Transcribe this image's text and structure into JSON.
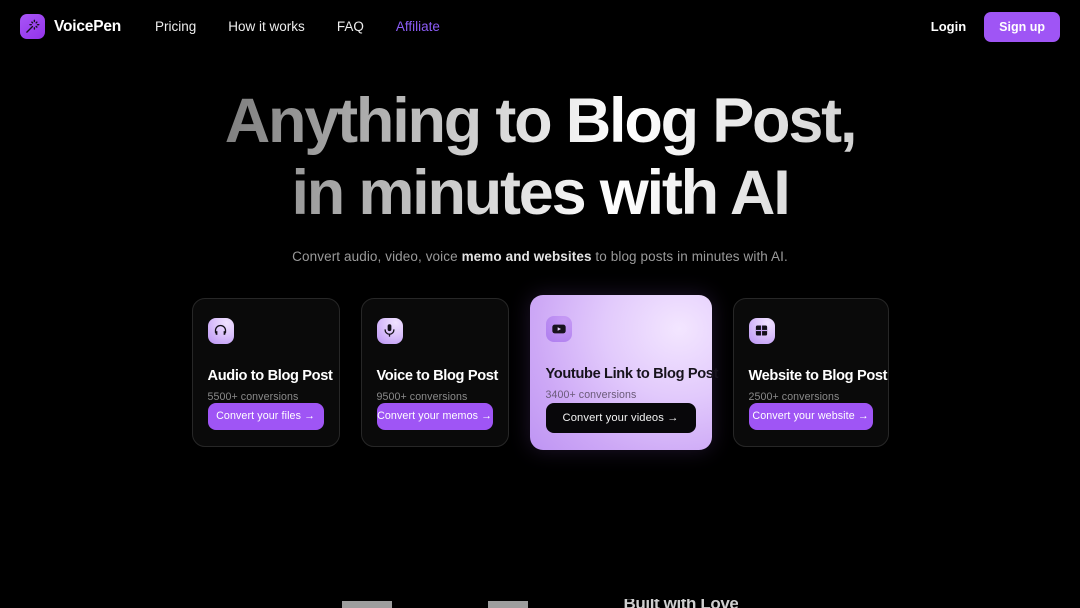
{
  "brand": {
    "name": "VoicePen",
    "logo_icon": "magic-wand-icon",
    "logo_color": "#a855f7"
  },
  "nav": {
    "links": [
      {
        "label": "Pricing",
        "accent": false
      },
      {
        "label": "How it works",
        "accent": false
      },
      {
        "label": "FAQ",
        "accent": false
      },
      {
        "label": "Affiliate",
        "accent": true,
        "color": "#8b5cf6"
      }
    ],
    "login_label": "Login",
    "signup_label": "Sign up",
    "signup_color": "#9f55f5"
  },
  "hero": {
    "headline_line1": "Anything to Blog Post,",
    "headline_line2": "in minutes with AI",
    "sub_parts": [
      {
        "text": "Convert audio, video, voice ",
        "emphasis": false
      },
      {
        "text": "memo and websites",
        "emphasis": true
      },
      {
        "text": " to blog posts in minutes with AI.",
        "emphasis": false
      }
    ]
  },
  "cards": [
    {
      "icon": "headphones-icon",
      "title": "Audio to Blog Post",
      "conversions": "5500+ conversions",
      "button_label": "Convert your files →",
      "featured": false
    },
    {
      "icon": "microphone-icon",
      "title": "Voice to Blog Post",
      "conversions": "9500+ conversions",
      "button_label": "Convert your memos →",
      "featured": false
    },
    {
      "icon": "youtube-icon",
      "title": "Youtube Link to Blog Post",
      "conversions": "3400+ conversions",
      "button_label": "Convert your videos →",
      "featured": true
    },
    {
      "icon": "window-icon",
      "title": "Website to Blog Post",
      "conversions": "2500+ conversions",
      "button_label": "Convert your website →",
      "featured": false
    }
  ],
  "bottom_cutoff": {
    "word": "Built with Love"
  }
}
